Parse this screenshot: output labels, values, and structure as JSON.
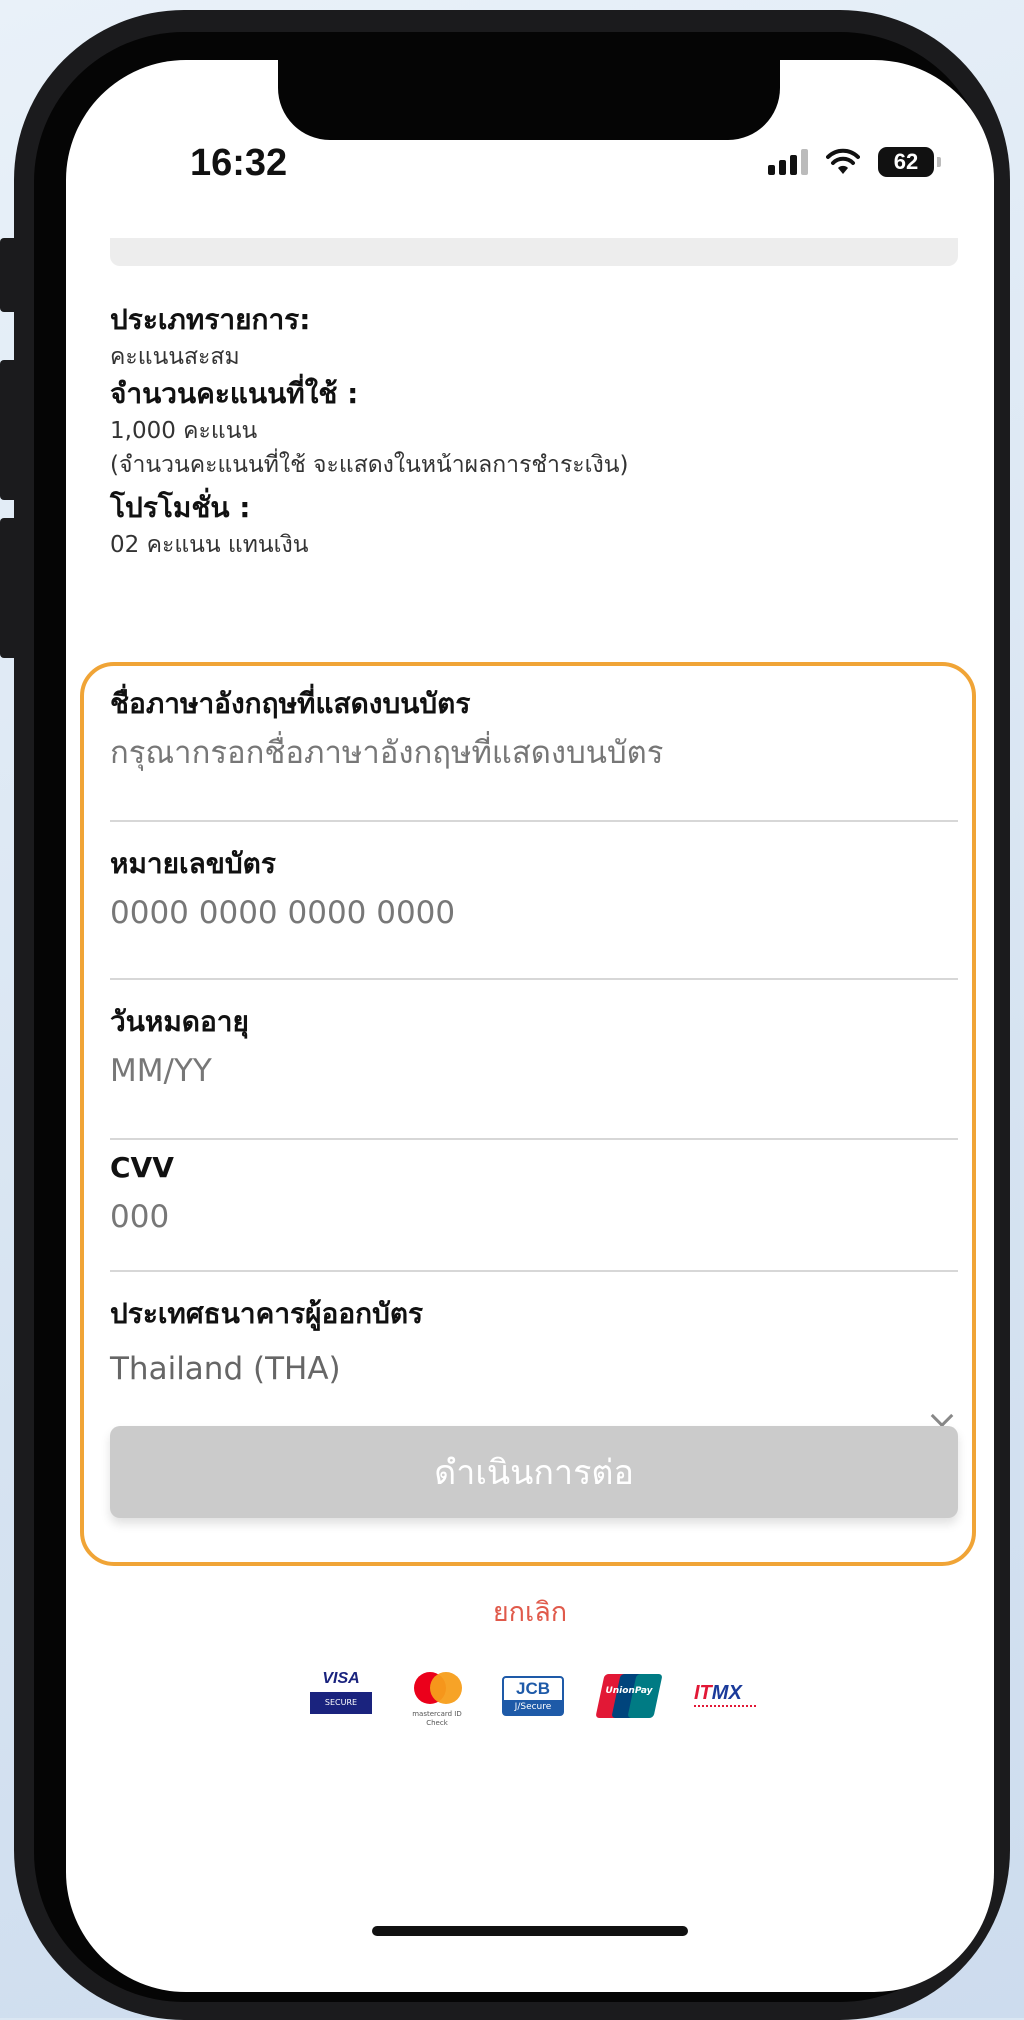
{
  "status_bar": {
    "time": "16:32",
    "battery": "62",
    "icons": [
      "signal-icon",
      "wifi-icon",
      "battery-icon"
    ]
  },
  "summary": {
    "transaction_type_label": "ประเภทรายการ:",
    "transaction_type_value": "คะแนนสะสม",
    "points_used_label": "จำนวนคะแนนที่ใช้ :",
    "points_used_value": "1,000 คะแนน",
    "points_note": "(จำนวนคะแนนที่ใช้ จะแสดงในหน้าผลการชำระเงิน)",
    "promotion_label": "โปรโมชั่น :",
    "promotion_value": "02 คะแนน แทนเงิน"
  },
  "form": {
    "name": {
      "label": "ชื่อภาษาอังกฤษที่แสดงบนบัตร",
      "placeholder": "กรุณากรอกชื่อภาษาอังกฤษที่แสดงบนบัตร"
    },
    "card_number": {
      "label": "หมายเลขบัตร",
      "placeholder": "0000 0000 0000 0000"
    },
    "expiry": {
      "label": "วันหมดอายุ",
      "placeholder": "MM/YY"
    },
    "cvv": {
      "label": "CVV",
      "placeholder": "000"
    },
    "country": {
      "label": "ประเทศธนาคารผู้ออกบัตร",
      "value": "Thailand (THA)"
    }
  },
  "actions": {
    "continue_label": "ดำเนินการต่อ",
    "cancel_label": "ยกเลิก"
  },
  "logos": {
    "visa_top": "VISA",
    "visa_bottom": "SECURE",
    "mastercard_text": "mastercard ID Check",
    "jcb_top": "JCB",
    "jcb_bottom": "J/Secure",
    "unionpay_text": "UnionPay",
    "itmx_a": "IT",
    "itmx_b": "MX"
  },
  "colors": {
    "highlight": "#f0a436",
    "cancel": "#e05a4b",
    "button_disabled": "#cbcbcb"
  }
}
